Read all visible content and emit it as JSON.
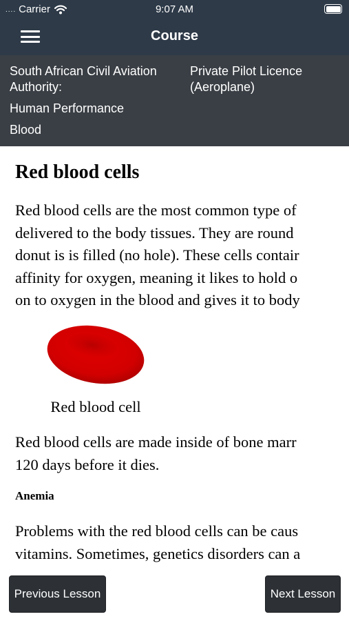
{
  "status_bar": {
    "signal_dots": "....",
    "carrier": "Carrier",
    "time": "9:07 AM",
    "wifi_icon": "wifi-icon",
    "battery_icon": "battery-icon",
    "battery_level": 1.0
  },
  "nav": {
    "title": "Course",
    "menu_icon": "hamburger-menu-icon"
  },
  "course": {
    "authority": "South African Civil Aviation Authority:",
    "licence": "Private Pilot Licence (Aeroplane)",
    "subject": "Human Performance",
    "topic": "Blood"
  },
  "lesson": {
    "title": "Red blood cells",
    "paragraph1_lines": [
      "Red blood cells are the most common type of",
      "delivered to the body tissues. They are round",
      "donut is is filled (no hole). These cells contair",
      "affinity for oxygen, meaning it likes to hold o",
      "on to oxygen in the blood and gives it to body"
    ],
    "figure_caption": "Red blood cell",
    "paragraph2_lines": [
      "Red blood cells are made inside of bone marr",
      "120 days before it dies."
    ],
    "section_heading": "Anemia",
    "paragraph3_lines": [
      "Problems with the red blood cells can be caus",
      "vitamins. Sometimes, genetics disorders can a"
    ]
  },
  "buttons": {
    "previous": "Previous Lesson",
    "next": "Next Lesson"
  },
  "colors": {
    "nav_bar": "#2e3a48",
    "course_header": "#3a3f45",
    "button": "#2d3136",
    "blood_cell": "#dd0000"
  }
}
